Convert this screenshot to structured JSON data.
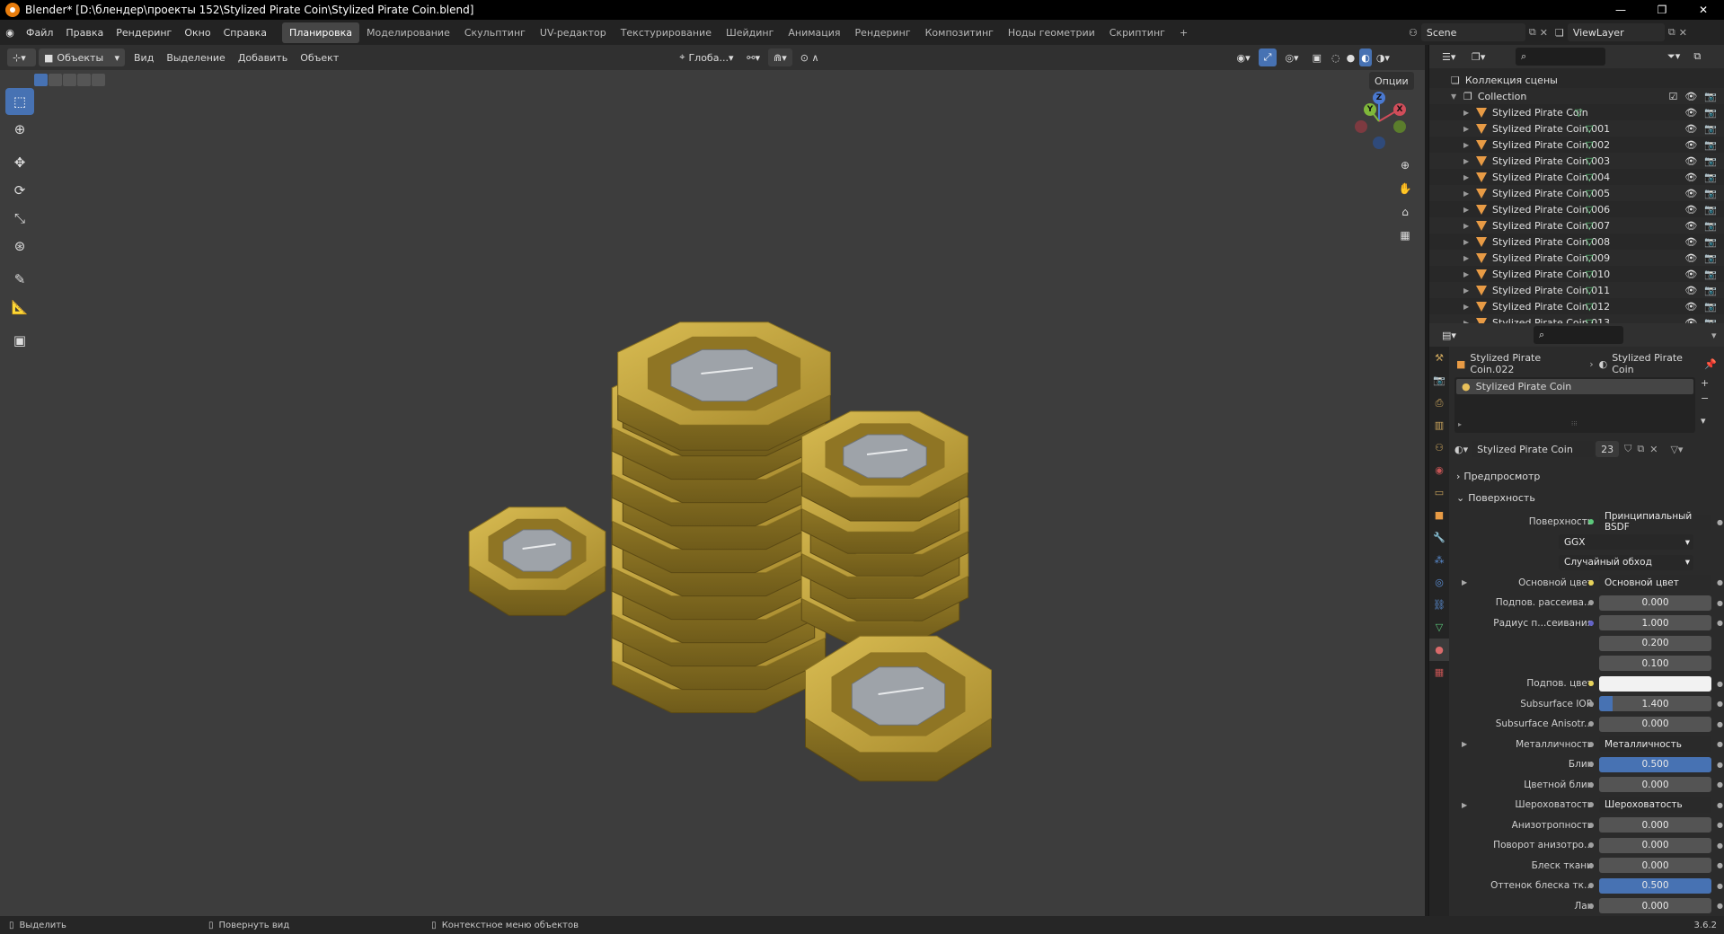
{
  "titlebar": {
    "title": "Blender* [D:\\блендер\\проекты 152\\Stylized Pirate Coin\\Stylized Pirate Coin.blend]"
  },
  "menu": [
    "Файл",
    "Правка",
    "Рендеринг",
    "Окно",
    "Справка"
  ],
  "workspaces": [
    "Планировка",
    "Моделирование",
    "Скульптинг",
    "UV-редактор",
    "Текстурирование",
    "Шейдинг",
    "Анимация",
    "Рендеринг",
    "Композитинг",
    "Ноды геометрии",
    "Скриптинг"
  ],
  "workspace_add": "+",
  "scene": {
    "name": "Scene",
    "viewlayer": "ViewLayer"
  },
  "viewport_header": {
    "mode": "Объекты",
    "menus": [
      "Вид",
      "Выделение",
      "Добавить",
      "Объект"
    ],
    "transform": "Глоба...",
    "options": "Опции"
  },
  "gizmo": {
    "x": "X",
    "y": "Y",
    "z": "Z"
  },
  "outliner": {
    "collection_root": "Коллекция сцены",
    "collection": "Collection",
    "objects": [
      "Stylized Pirate Coin",
      "Stylized Pirate Coin.001",
      "Stylized Pirate Coin.002",
      "Stylized Pirate Coin.003",
      "Stylized Pirate Coin.004",
      "Stylized Pirate Coin.005",
      "Stylized Pirate Coin.006",
      "Stylized Pirate Coin.007",
      "Stylized Pirate Coin.008",
      "Stylized Pirate Coin.009",
      "Stylized Pirate Coin.010",
      "Stylized Pirate Coin.011",
      "Stylized Pirate Coin.012",
      "Stylized Pirate Coin.013"
    ]
  },
  "properties": {
    "breadcrumb_object": "Stylized Pirate Coin.022",
    "breadcrumb_material": "Stylized Pirate Coin",
    "slot": "Stylized Pirate Coin",
    "material_name": "Stylized Pirate Coin",
    "users": "23",
    "preview": "Предпросмотр",
    "surface_panel": "Поверхность",
    "rows": [
      {
        "label": "Поверхность",
        "value": "Принципиальный BSDF",
        "kind": "link",
        "dot": "#5cc97b"
      },
      {
        "label": "",
        "value": "GGX",
        "kind": "select"
      },
      {
        "label": "",
        "value": "Случайный обход",
        "kind": "select"
      },
      {
        "label": "Основной цвет",
        "value": "Основной цвет",
        "kind": "link",
        "dot": "#e8d35a",
        "expand": true
      },
      {
        "label": "Подпов. рассеива...",
        "value": "0.000",
        "kind": "num",
        "dot": "#a0a0a0"
      },
      {
        "label": "Радиус п...сеивания",
        "value": "1.000",
        "kind": "num",
        "dot": "#6363c7"
      },
      {
        "label": "",
        "value": "0.200",
        "kind": "num"
      },
      {
        "label": "",
        "value": "0.100",
        "kind": "num"
      },
      {
        "label": "Подпов. цвет",
        "value": "",
        "kind": "color",
        "dot": "#e8d35a"
      },
      {
        "label": "Subsurface IOR",
        "value": "1.400",
        "kind": "bar",
        "fill": 0.12,
        "dot": "#a0a0a0"
      },
      {
        "label": "Subsurface Anisotr...",
        "value": "0.000",
        "kind": "num",
        "dot": "#a0a0a0"
      },
      {
        "label": "Металличность",
        "value": "Металличность",
        "kind": "link",
        "dot": "#a0a0a0",
        "expand": true
      },
      {
        "label": "Блик",
        "value": "0.500",
        "kind": "bar",
        "fill": 1.0,
        "dot": "#a0a0a0"
      },
      {
        "label": "Цветной блик",
        "value": "0.000",
        "kind": "num",
        "dot": "#a0a0a0"
      },
      {
        "label": "Шероховатость",
        "value": "Шероховатость",
        "kind": "link",
        "dot": "#a0a0a0",
        "expand": true
      },
      {
        "label": "Анизотропность",
        "value": "0.000",
        "kind": "num",
        "dot": "#a0a0a0"
      },
      {
        "label": "Поворот анизотро...",
        "value": "0.000",
        "kind": "num",
        "dot": "#a0a0a0"
      },
      {
        "label": "Блеск ткани",
        "value": "0.000",
        "kind": "num",
        "dot": "#a0a0a0"
      },
      {
        "label": "Оттенок блеска тк...",
        "value": "0.500",
        "kind": "bar",
        "fill": 1.0,
        "dot": "#a0a0a0"
      },
      {
        "label": "Лак",
        "value": "0.000",
        "kind": "num",
        "dot": "#a0a0a0"
      }
    ]
  },
  "statusbar": {
    "select": "Выделить",
    "rotate": "Повернуть вид",
    "context": "Контекстное меню объектов",
    "version": "3.6.2"
  },
  "colors": {
    "accent": "#4772b3",
    "gold": "#b99a35",
    "silver": "#9ea3a9",
    "object_icon": "#e89b45",
    "mesh_icon": "#5cc97b"
  }
}
